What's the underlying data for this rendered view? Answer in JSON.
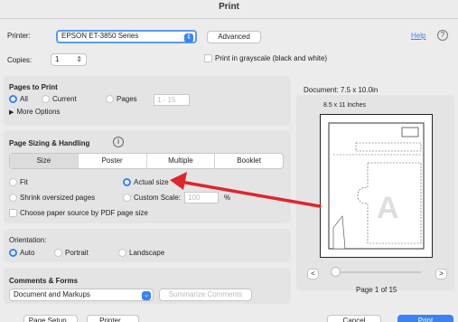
{
  "window": {
    "title": "Print"
  },
  "printer": {
    "label": "Printer:",
    "value": "EPSON ET-3850 Series",
    "advanced_label": "Advanced",
    "help_label": "Help",
    "help_icon": "?"
  },
  "copies": {
    "label": "Copies:",
    "value": "1",
    "grayscale_label": "Print in grayscale (black and white)"
  },
  "pages": {
    "title": "Pages to Print",
    "all_label": "All",
    "current_label": "Current",
    "pages_label": "Pages",
    "range_value": "1 - 15",
    "more_options_label": "More Options"
  },
  "sizing": {
    "title": "Page Sizing & Handling",
    "info_icon": "i",
    "tabs": [
      "Size",
      "Poster",
      "Multiple",
      "Booklet"
    ],
    "fit_label": "Fit",
    "actual_label": "Actual size",
    "shrink_label": "Shrink oversized pages",
    "custom_label": "Custom Scale:",
    "custom_value": "100",
    "custom_unit": "%",
    "choose_source_label": "Choose paper source by PDF page size"
  },
  "orientation": {
    "title": "Orientation:",
    "auto_label": "Auto",
    "portrait_label": "Portrait",
    "landscape_label": "Landscape"
  },
  "comments": {
    "title": "Comments & Forms",
    "value": "Document and Markups",
    "summarize_label": "Summarize Comments"
  },
  "preview": {
    "document_label": "Document: 7.5 x 10.0in",
    "paper_label": "8.5 x 11 Inches",
    "prev_label": "<",
    "next_label": ">",
    "page_label": "Page 1 of 15",
    "slider_fraction": 0.0
  },
  "footer": {
    "page_setup_label": "Page Setup...",
    "printer_label": "Printer...",
    "cancel_label": "Cancel",
    "print_label": "Print"
  },
  "colors": {
    "accent": "#3b82f6",
    "arrow": "#e0252b"
  }
}
